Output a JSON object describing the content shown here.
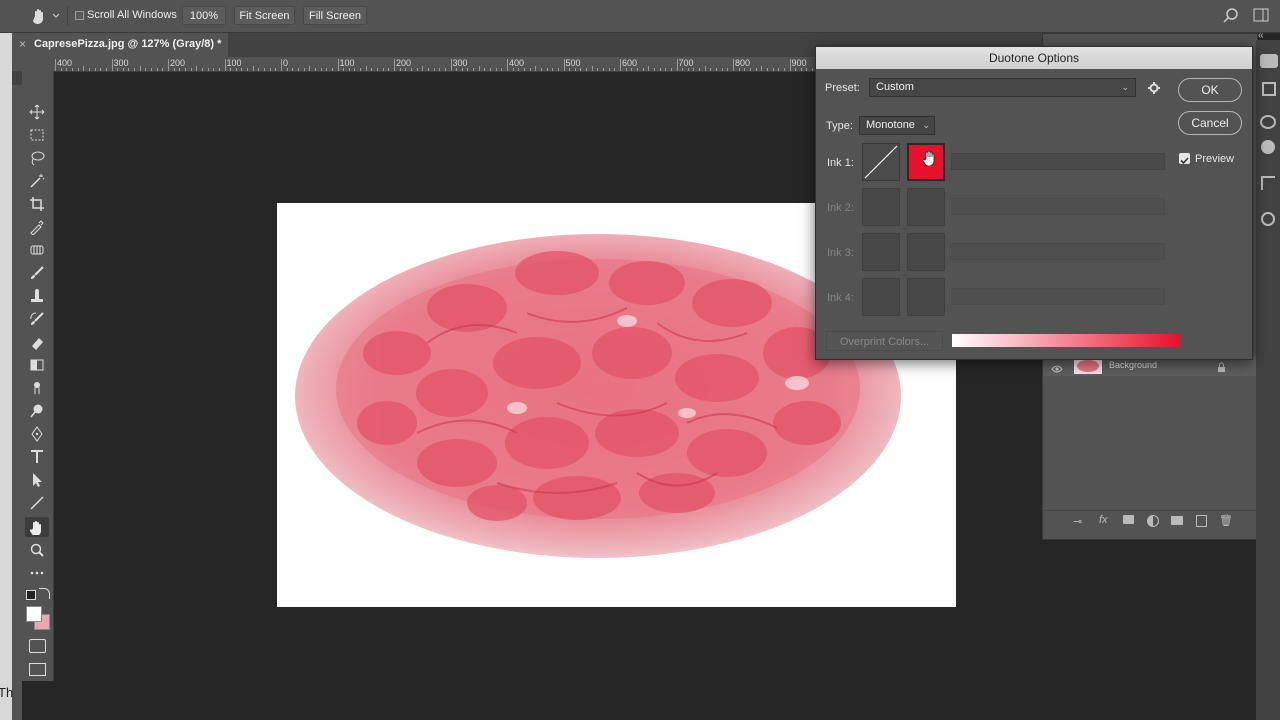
{
  "options_bar": {
    "scroll_all_windows_label": "Scroll All Windows",
    "zoom_label": "100%",
    "fit_screen_label": "Fit Screen",
    "fill_screen_label": "Fill Screen"
  },
  "document_tab": {
    "close_glyph": "×",
    "title": "CapresePizza.jpg @ 127% (Gray/8) *"
  },
  "ruler": {
    "labels": [
      "400",
      "300",
      "200",
      "100",
      "0",
      "100",
      "200",
      "300",
      "400",
      "500",
      "600",
      "700",
      "800",
      "900"
    ]
  },
  "toolbox": {
    "tools": [
      "move-tool-icon",
      "marquee-tool-icon",
      "lasso-tool-icon",
      "magic-wand-icon",
      "crop-tool-icon",
      "eyedropper-icon",
      "patch-tool-icon",
      "brush-tool-icon",
      "stamp-tool-icon",
      "history-brush-icon",
      "eraser-tool-icon",
      "gradient-tool-icon",
      "smudge-tool-icon",
      "dodge-tool-icon",
      "pen-tool-icon",
      "type-tool-icon",
      "path-selection-icon",
      "line-tool-icon",
      "hand-tool-icon",
      "zoom-tool-icon",
      "more-tools-icon"
    ],
    "active_tool": "hand-tool-icon",
    "foreground_color": "#ffffff",
    "background_color": "#e8a7b2"
  },
  "layers": {
    "background_layer_name": "Background"
  },
  "dialog": {
    "title": "Duotone Options",
    "preset_label": "Preset:",
    "preset_value": "Custom",
    "type_label": "Type:",
    "type_value": "Monotone",
    "ok_label": "OK",
    "cancel_label": "Cancel",
    "preview_label": "Preview",
    "preview_checked": true,
    "inks": [
      {
        "label": "Ink 1:",
        "color": "#e8102b",
        "name": "",
        "enabled": true
      },
      {
        "label": "Ink 2:",
        "color": "",
        "name": "",
        "enabled": false
      },
      {
        "label": "Ink 3:",
        "color": "",
        "name": "",
        "enabled": false
      },
      {
        "label": "Ink 4:",
        "color": "",
        "name": "",
        "enabled": false
      }
    ],
    "overprint_label": "Overprint Colors...",
    "ramp_start_color": "#ffffff",
    "ramp_end_color": "#e8102b"
  },
  "left_edge_text": "Th"
}
